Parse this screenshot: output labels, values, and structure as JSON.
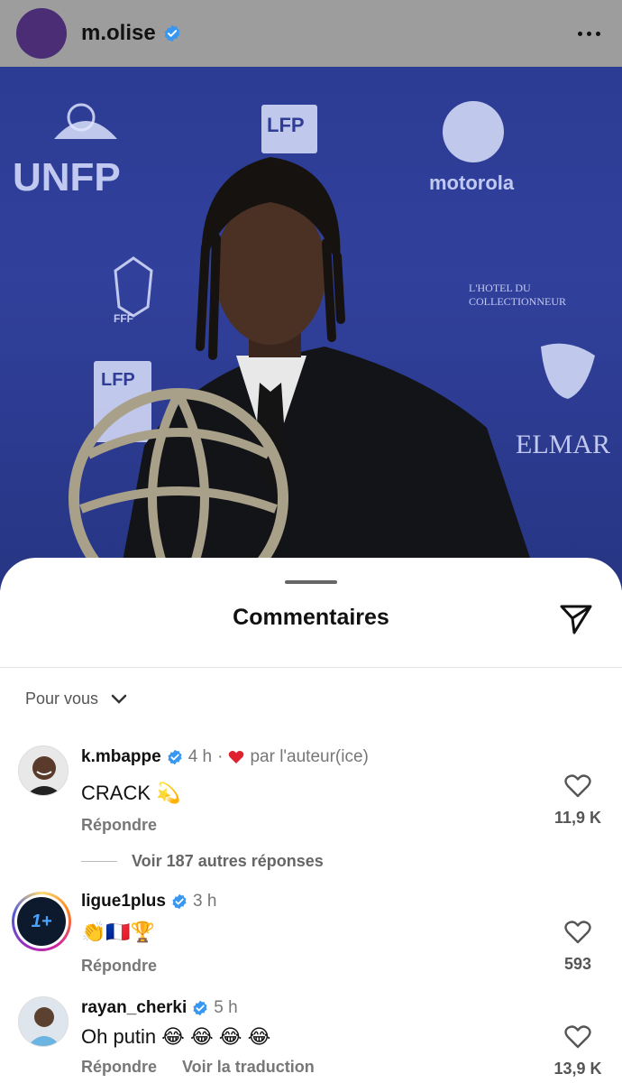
{
  "post": {
    "username": "m.olise",
    "photo_sponsors": [
      "UNFP",
      "LFP",
      "motorola",
      "FFF",
      "L'HOTEL DU COLLECTIONNEUR",
      "LFP",
      "ELMAR"
    ]
  },
  "comments_sheet": {
    "title": "Commentaires",
    "filter_label": "Pour vous",
    "comments": [
      {
        "username": "k.mbappe",
        "time": "4 h",
        "separator": "·",
        "liked_by_author_label": "par l'auteur(ice)",
        "text": "CRACK",
        "emojis": "💫",
        "reply_label": "Répondre",
        "like_count": "11,9 K",
        "view_replies_label": "Voir 187 autres réponses"
      },
      {
        "username": "ligue1plus",
        "time": "3 h",
        "text": "",
        "emojis": "👏🇫🇷🏆",
        "reply_label": "Répondre",
        "like_count": "593"
      },
      {
        "username": "rayan_cherki",
        "time": "5 h",
        "text": "Oh putin",
        "emojis": "😂 😂 😂 😂",
        "reply_label": "Répondre",
        "translate_label": "Voir la traduction",
        "like_count": "13,9 K"
      }
    ]
  },
  "colors": {
    "dim_overlay": "#9d9d9d",
    "photo_background": "#2f3d96",
    "verified_blue": "#3897f0",
    "heart_red": "#e0212f",
    "story_ring": "#d6249f"
  }
}
